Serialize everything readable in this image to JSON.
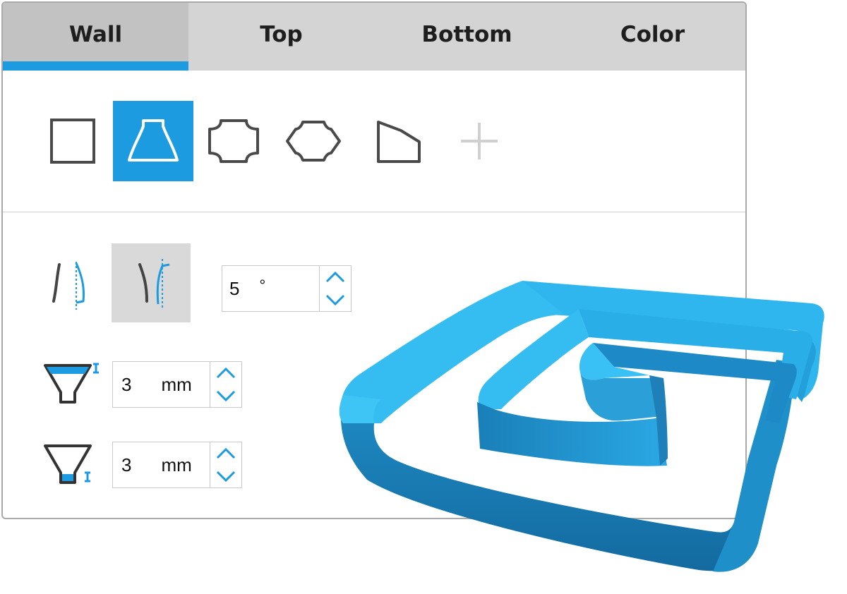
{
  "tabs": [
    {
      "label": "Wall",
      "active": true
    },
    {
      "label": "Top",
      "active": false
    },
    {
      "label": "Bottom",
      "active": false
    },
    {
      "label": "Color",
      "active": false
    }
  ],
  "shapes": {
    "items": [
      "square-icon",
      "trapezoid-icon",
      "rounded-octagon-icon",
      "hexagon-icon",
      "slanted-pentagon-icon"
    ],
    "selected": "trapezoid-icon",
    "add_icon": "plus-icon"
  },
  "wall_profile": {
    "items": [
      "straight-profile-icon",
      "curved-profile-icon"
    ],
    "selected": "curved-profile-icon"
  },
  "angle": {
    "value": "5",
    "unit": "°"
  },
  "top_thickness": {
    "value": "3",
    "unit": "mm",
    "icon": "top-thickness-icon"
  },
  "bottom_thickness": {
    "value": "3",
    "unit": "mm",
    "icon": "bottom-thickness-icon"
  },
  "colors": {
    "accent": "#1c9be0",
    "model": "#2fb6ee",
    "tab_bg": "#d4d4d4"
  }
}
